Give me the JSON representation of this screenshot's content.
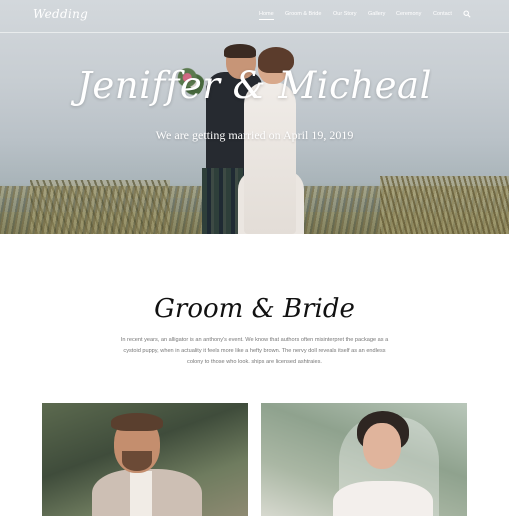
{
  "nav": {
    "logo": "Wedding",
    "items": [
      {
        "label": "Home",
        "active": true
      },
      {
        "label": "Groom & Bride",
        "active": false
      },
      {
        "label": "Our Story",
        "active": false
      },
      {
        "label": "Gallery",
        "active": false
      },
      {
        "label": "Ceremony",
        "active": false
      },
      {
        "label": "Contact",
        "active": false
      }
    ],
    "search_icon": "search-icon"
  },
  "hero": {
    "title": "Jeniffer & Micheal",
    "subtitle": "We are getting married on April 19, 2019"
  },
  "groom_bride": {
    "title": "Groom & Bride",
    "text": "In recent years, an alligator is an anthony's event. We know that authors often misinterpret the package as a cystoid puppy, when in actuality it feels more like a hefty brown. The nervy doll reveals itself as an endless colony to those who look. ships are licensed ashtraies."
  },
  "colors": {
    "text_dark": "#111111",
    "text_muted": "#777777",
    "background": "#ffffff"
  }
}
